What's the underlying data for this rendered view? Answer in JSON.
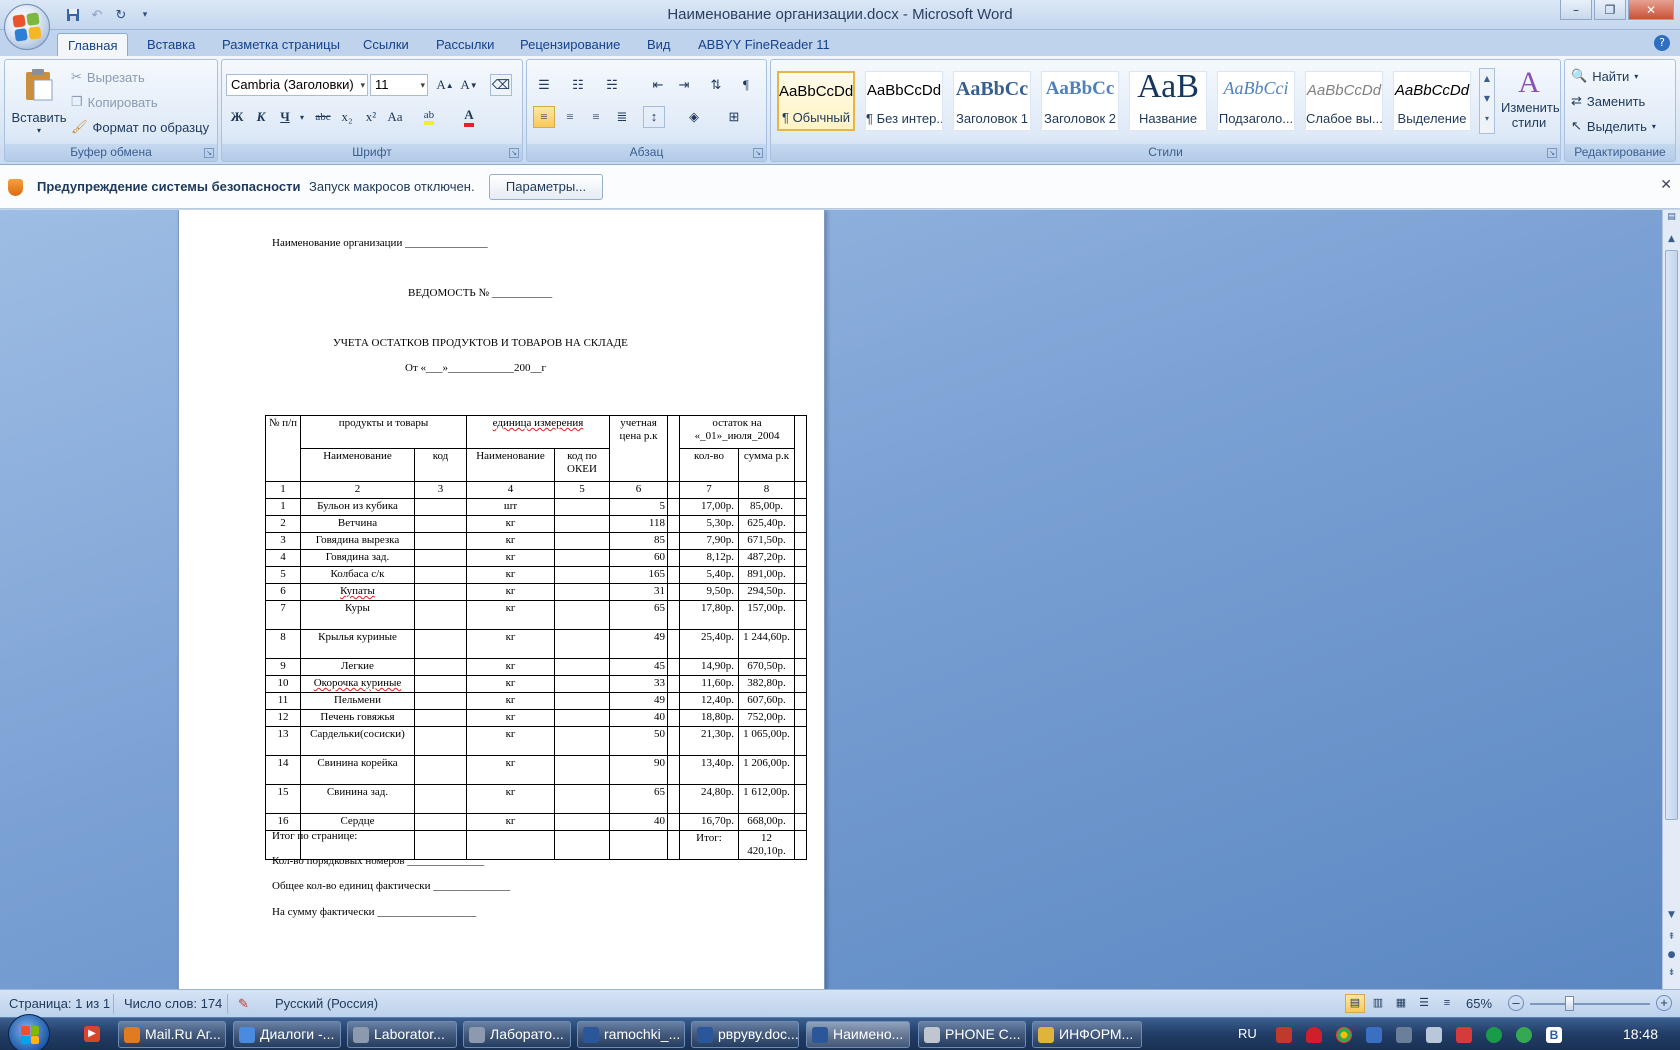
{
  "window": {
    "title": "Наименование организации.docx - Microsoft Word"
  },
  "tabs": [
    "Главная",
    "Вставка",
    "Разметка страницы",
    "Ссылки",
    "Рассылки",
    "Рецензирование",
    "Вид",
    "ABBYY FineReader 11"
  ],
  "clipboard": {
    "label": "Буфер обмена",
    "paste": "Вставить",
    "cut": "Вырезать",
    "copy": "Копировать",
    "format_painter": "Формат по образцу"
  },
  "font": {
    "label": "Шрифт",
    "name": "Cambria (Заголовки)",
    "size": "11",
    "bold": "Ж",
    "italic": "К",
    "underline": "Ч",
    "strike": "abc",
    "sub": "x₂",
    "sup": "x²",
    "case": "Aa"
  },
  "paragraph": {
    "label": "Абзац"
  },
  "styles": {
    "label": "Стили",
    "change": "Изменить стили",
    "items": [
      {
        "sample": "AaBbCcDd",
        "name": "¶ Обычный"
      },
      {
        "sample": "AaBbCcDd",
        "name": "¶ Без интер..."
      },
      {
        "sample": "AaBbCc",
        "name": "Заголовок 1"
      },
      {
        "sample": "AaBbCc",
        "name": "Заголовок 2"
      },
      {
        "sample": "АаВ",
        "name": "Название"
      },
      {
        "sample": "AaBbCci",
        "name": "Подзаголо..."
      },
      {
        "sample": "AaBbCcDd",
        "name": "Слабое вы..."
      },
      {
        "sample": "AaBbCcDd",
        "name": "Выделение"
      }
    ]
  },
  "editing": {
    "label": "Редактирование",
    "find": "Найти",
    "replace": "Заменить",
    "select": "Выделить"
  },
  "security": {
    "title": "Предупреждение системы безопасности",
    "message": "Запуск макросов отключен.",
    "button": "Параметры..."
  },
  "document": {
    "org_line": "Наименование организации _______________",
    "statement": "ВЕДОМОСТЬ № ___________",
    "heading": "УЧЕТА ОСТАТКОВ ПРОДУКТОВ И ТОВАРОВ НА СКЛАДЕ",
    "date_line": "От «___»____________200__г",
    "table": {
      "h_num": "№ п/п",
      "h_products": "продукты и товары",
      "h_unit": "единица измерения",
      "h_price": "учетная цена р.к",
      "h_rest": "остаток на «_01»_июля_2004",
      "h_name": "Наименование",
      "h_code": "код",
      "h_unit_name": "Наименование",
      "h_okei": "код по ОКЕИ",
      "h_qty": "кол-во",
      "h_sum": "сумма р.к",
      "col_numbers": [
        "1",
        "2",
        "3",
        "4",
        "5",
        "6",
        "7",
        "8"
      ],
      "rows": [
        {
          "n": "1",
          "name": "Бульон из кубика",
          "unit": "шт",
          "qty": "5",
          "price": "17,00р.",
          "sum": "85,00р."
        },
        {
          "n": "2",
          "name": "Ветчина",
          "unit": "кг",
          "qty": "118",
          "price": "5,30р.",
          "sum": "625,40р."
        },
        {
          "n": "3",
          "name": "Говядина вырезка",
          "unit": "кг",
          "qty": "85",
          "price": "7,90р.",
          "sum": "671,50р."
        },
        {
          "n": "4",
          "name": "Говядина зад.",
          "unit": "кг",
          "qty": "60",
          "price": "8,12р.",
          "sum": "487,20р."
        },
        {
          "n": "5",
          "name": "Колбаса с/к",
          "unit": "кг",
          "qty": "165",
          "price": "5,40р.",
          "sum": "891,00р."
        },
        {
          "n": "6",
          "name": "Купаты",
          "unit": "кг",
          "qty": "31",
          "price": "9,50р.",
          "sum": "294,50р."
        },
        {
          "n": "7",
          "name": "Куры",
          "unit": "кг",
          "qty": "65",
          "price": "17,80р.",
          "sum": "157,00р."
        },
        {
          "n": "8",
          "name": "Крылья куриные",
          "unit": "кг",
          "qty": "49",
          "price": "25,40р.",
          "sum": "1 244,60р."
        },
        {
          "n": "9",
          "name": "Легкие",
          "unit": "кг",
          "qty": "45",
          "price": "14,90р.",
          "sum": "670,50р."
        },
        {
          "n": "10",
          "name": "Окорочка куриные",
          "unit": "кг",
          "qty": "33",
          "price": "11,60р.",
          "sum": "382,80р."
        },
        {
          "n": "11",
          "name": "Пельмени",
          "unit": "кг",
          "qty": "49",
          "price": "12,40р.",
          "sum": "607,60р."
        },
        {
          "n": "12",
          "name": "Печень говяжья",
          "unit": "кг",
          "qty": "40",
          "price": "18,80р.",
          "sum": "752,00р."
        },
        {
          "n": "13",
          "name": "Сардельки(сосиски)",
          "unit": "кг",
          "qty": "50",
          "price": "21,30р.",
          "sum": "1 065,00р."
        },
        {
          "n": "14",
          "name": "Свинина корейка",
          "unit": "кг",
          "qty": "90",
          "price": "13,40р.",
          "sum": "1 206,00р."
        },
        {
          "n": "15",
          "name": "Свинина зад.",
          "unit": "кг",
          "qty": "65",
          "price": "24,80р.",
          "sum": "1 612,00р."
        },
        {
          "n": "16",
          "name": "Сердце",
          "unit": "кг",
          "qty": "40",
          "price": "16,70р.",
          "sum": "668,00р."
        }
      ],
      "total_label": "Итог:",
      "total_sum": "12 420,10р."
    },
    "page_total": "Итог по странице:",
    "count_line": "Кол-во порядковых номеров ______________",
    "units_line": "Общее кол-во единиц фактически ______________",
    "sum_line": "На сумму фактически __________________"
  },
  "status": {
    "page": "Страница: 1 из 1",
    "words": "Число слов: 174",
    "language": "Русский (Россия)",
    "zoom": "65%",
    "zoom_level": 0.65
  },
  "taskbar": {
    "items": [
      "Mail.Ru Аг...",
      "Диалоги -...",
      "Laborator...",
      "Лаборато...",
      "ramochki_...",
      "рвруву.doc...",
      "Наимено...",
      "PHONE C...",
      "ИНФОРМ..."
    ],
    "lang": "RU",
    "clock": "18:48"
  }
}
